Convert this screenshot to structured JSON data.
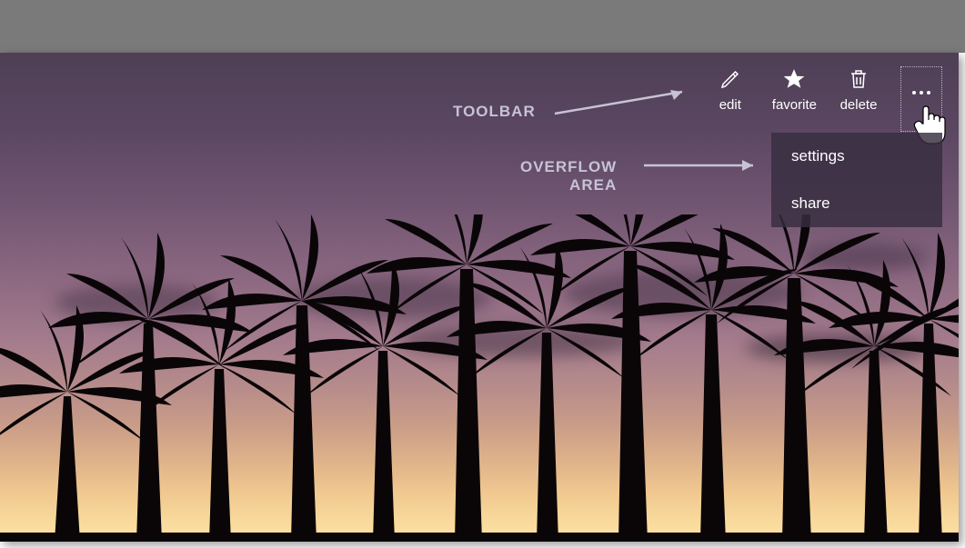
{
  "toolbar": {
    "edit_label": "edit",
    "favorite_label": "favorite",
    "delete_label": "delete"
  },
  "overflow": {
    "settings_label": "settings",
    "share_label": "share"
  },
  "annotations": {
    "toolbar_label": "TOOLBAR",
    "overflow_label_line1": "OVERFLOW",
    "overflow_label_line2": "AREA"
  }
}
